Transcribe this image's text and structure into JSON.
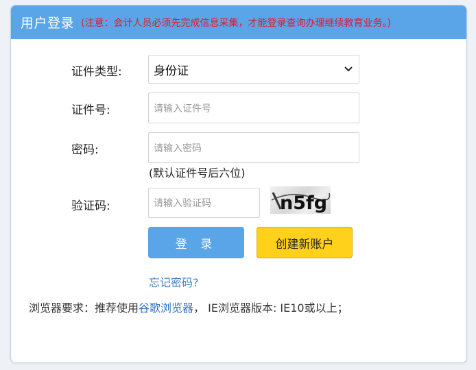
{
  "header": {
    "title": "用户登录",
    "notice": "(注意：会计人员必须先完成信息采集，才能登录查询办理继续教育业务。)"
  },
  "form": {
    "cert_type": {
      "label": "证件类型:",
      "selected": "身份证",
      "chevron_icon": "chevron-down-icon"
    },
    "cert_number": {
      "label": "证件号:",
      "placeholder": "请输入证件号"
    },
    "password": {
      "label": "密码:",
      "placeholder": "请输入密码",
      "hint": "(默认证件号后六位)"
    },
    "captcha": {
      "label": "验证码:",
      "placeholder": "请输入验证码",
      "image_text": "n5fg"
    }
  },
  "actions": {
    "login_label": "登 录",
    "register_label": "创建新账户",
    "forgot_label": "忘记密码?"
  },
  "requirements": {
    "prefix": "浏览器要求：推荐使用",
    "link": "谷歌浏览器",
    "suffix": "，  IE浏览器版本: IE10或以上；"
  },
  "colors": {
    "header_bg": "#5aa4e8",
    "notice_red": "#e3182d",
    "login_button": "#5aa4e8",
    "register_button": "#ffd11a",
    "link_blue": "#2d6fc1"
  }
}
